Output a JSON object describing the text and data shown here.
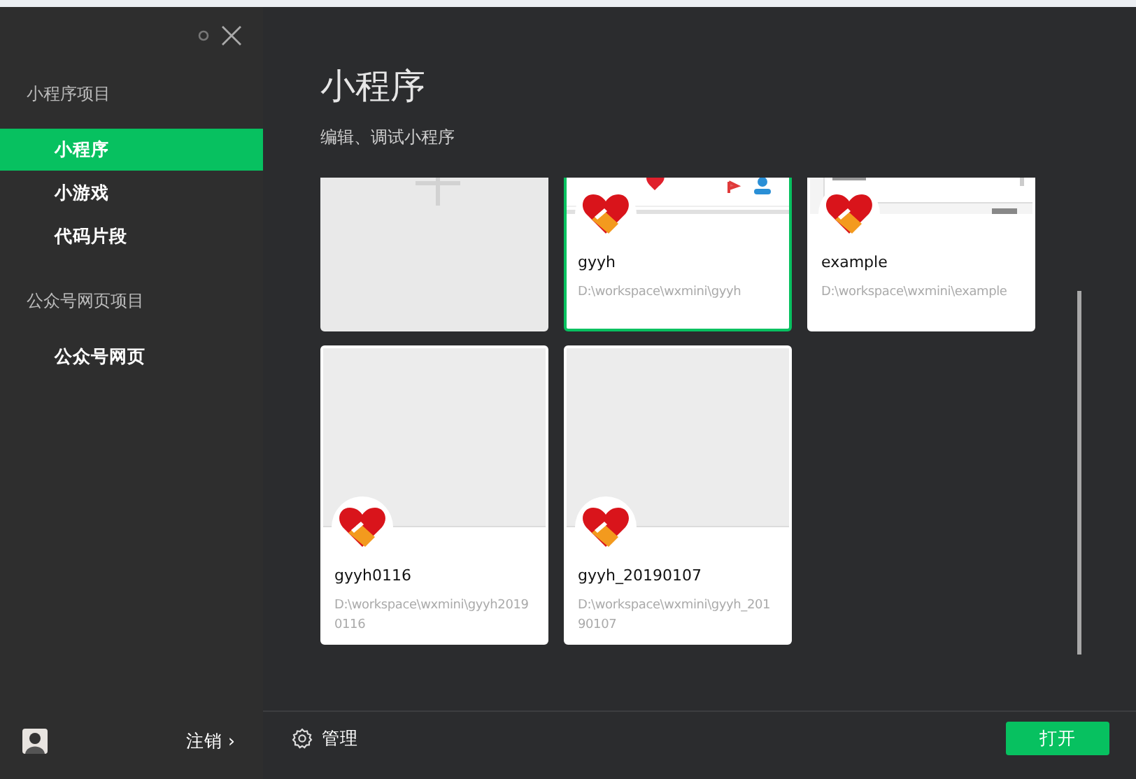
{
  "sidebar": {
    "sections": [
      {
        "title": "小程序项目",
        "items": [
          {
            "label": "小程序",
            "selected": true
          },
          {
            "label": "小游戏",
            "selected": false
          },
          {
            "label": "代码片段",
            "selected": false
          }
        ]
      },
      {
        "title": "公众号网页项目",
        "items": [
          {
            "label": "公众号网页",
            "selected": false
          }
        ]
      }
    ],
    "logout": "注销 ›"
  },
  "main": {
    "title": "小程序",
    "subtitle": "编辑、调试小程序",
    "cards": [
      {
        "kind": "new",
        "selected": false
      },
      {
        "kind": "project",
        "name": "gyyh",
        "path": "D:\\workspace\\wxmini\\gyyh",
        "selected": true
      },
      {
        "kind": "project",
        "name": "example",
        "path": "D:\\workspace\\wxmini\\example",
        "selected": false
      },
      {
        "kind": "project",
        "name": "gyyh0116",
        "path": "D:\\workspace\\wxmini\\gyyh20190116",
        "selected": false
      },
      {
        "kind": "project",
        "name": "gyyh_20190107",
        "path": "D:\\workspace\\wxmini\\gyyh_20190107",
        "selected": false
      }
    ],
    "manage": "管理",
    "open_button": "打开"
  }
}
